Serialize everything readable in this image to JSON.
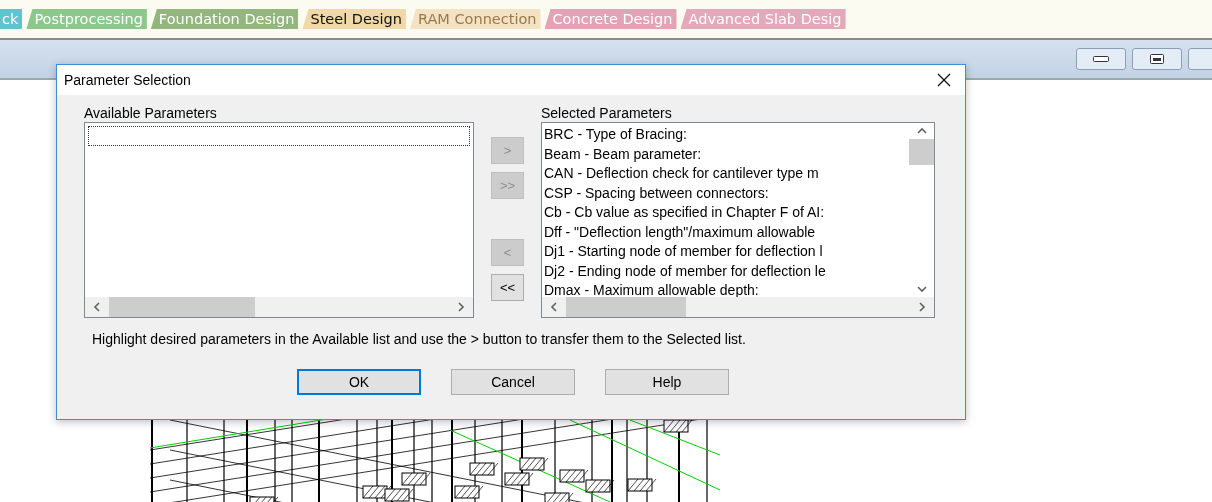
{
  "ribbon_tabs": [
    {
      "label": "ck",
      "selected": false,
      "color": "#5fc3d0"
    },
    {
      "label": "Postprocessing",
      "selected": false,
      "color": "#8cc88c"
    },
    {
      "label": "Foundation Design",
      "selected": false,
      "color": "#93b57e"
    },
    {
      "label": "Steel Design",
      "selected": true,
      "color": "#f0d8a8"
    },
    {
      "label": "RAM Connection",
      "selected": false,
      "color": "#f3e2c4"
    },
    {
      "label": "Concrete Design",
      "selected": false,
      "color": "#e3a3b6"
    },
    {
      "label": "Advanced Slab Desig",
      "selected": false,
      "color": "#e3a9bb"
    }
  ],
  "dialog": {
    "title": "Parameter Selection",
    "available": {
      "label": "Available Parameters"
    },
    "selected": {
      "label": "Selected Parameters",
      "items": [
        "BRC - Type of Bracing:",
        "Beam - Beam parameter:",
        "CAN - Deflection check for cantilever type m",
        "CSP - Spacing between connectors:",
        "Cb - Cb value as specified in Chapter F of AI:",
        "Dff - \"Deflection length\"/maximum allowable",
        "Dj1 - Starting node of member for deflection l",
        "Dj2 - Ending node of member for deflection le",
        "Dmax - Maximum allowable depth:"
      ]
    },
    "transfer_buttons": [
      {
        "label": ">",
        "disabled": true
      },
      {
        "label": ">>",
        "disabled": true
      },
      {
        "label": "<",
        "disabled": true
      },
      {
        "label": "<<",
        "disabled": false
      }
    ],
    "hint": "Highlight desired parameters in the Available list and use the > button to transfer them to the Selected list.",
    "buttons": [
      {
        "label": "OK",
        "default": true
      },
      {
        "label": "Cancel",
        "default": false
      },
      {
        "label": "Help",
        "default": false
      }
    ]
  }
}
